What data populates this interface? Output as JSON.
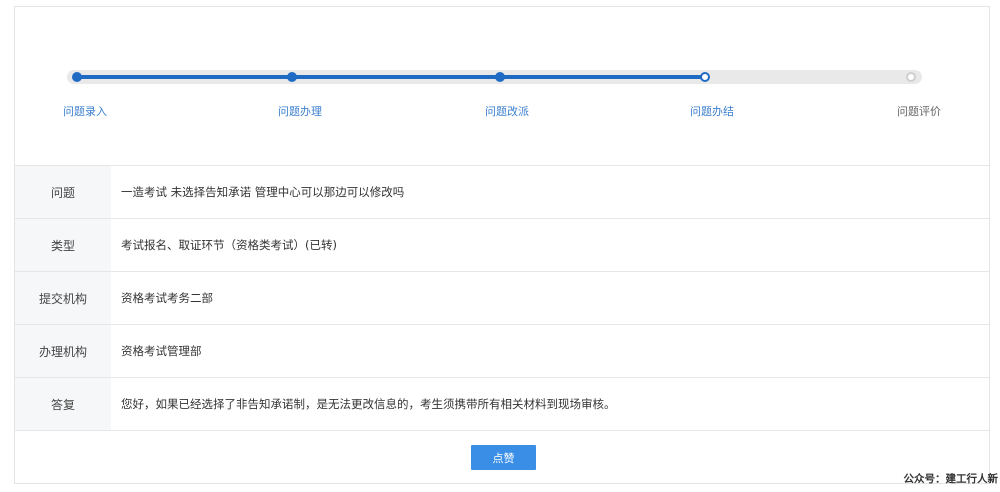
{
  "steps": [
    {
      "label": "问题录入",
      "state": "done"
    },
    {
      "label": "问题办理",
      "state": "done"
    },
    {
      "label": "问题改派",
      "state": "done"
    },
    {
      "label": "问题办结",
      "state": "current"
    },
    {
      "label": "问题评价",
      "state": "pending"
    }
  ],
  "rows": [
    {
      "label": "问题",
      "value": "一造考试 未选择告知承诺 管理中心可以那边可以修改吗"
    },
    {
      "label": "类型",
      "value": "考试报名、取证环节（资格类考试）(已转)"
    },
    {
      "label": "提交机构",
      "value": "资格考试考务二部"
    },
    {
      "label": "办理机构",
      "value": "资格考试管理部"
    },
    {
      "label": "答复",
      "value": "您好，如果已经选择了非告知承诺制，是无法更改信息的，考生须携带所有相关材料到现场审核。"
    }
  ],
  "like_button": {
    "label": "点赞"
  },
  "watermark": {
    "text": "公众号：建工行人新"
  },
  "colors": {
    "accent": "#1f6bc4",
    "button": "#3a8ee6",
    "track": "#e9e9e9",
    "label_bg": "#f6f7f9"
  }
}
